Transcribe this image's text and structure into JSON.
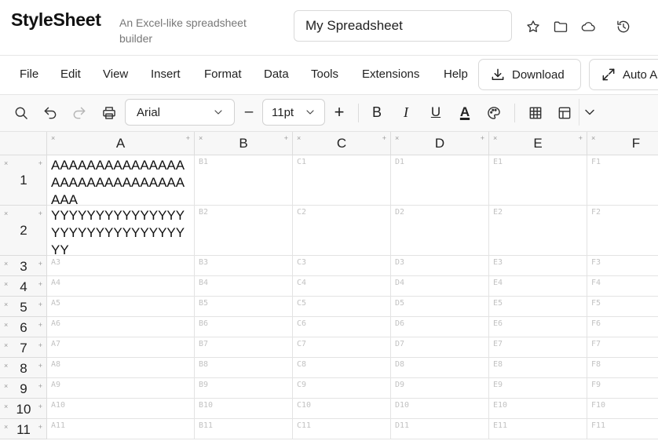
{
  "header": {
    "brand": "StyleSheet",
    "tagline": "An Excel-like spreadsheet builder",
    "title_value": "My Spreadsheet",
    "icons": [
      "star-icon",
      "folder-icon",
      "cloud-icon",
      "history-icon"
    ]
  },
  "menu": {
    "items": [
      "File",
      "Edit",
      "View",
      "Insert",
      "Format",
      "Data",
      "Tools",
      "Extensions",
      "Help"
    ],
    "download_label": "Download",
    "auto_label": "Auto A"
  },
  "toolbar": {
    "font": "Arial",
    "size": "11pt",
    "minus": "–",
    "plus": "+",
    "bold": "B",
    "italic": "I",
    "underline": "U",
    "text_color": "A"
  },
  "grid": {
    "columns": [
      "A",
      "B",
      "C",
      "D",
      "E",
      "F"
    ],
    "rows": [
      "1",
      "2",
      "3",
      "4",
      "5",
      "6",
      "7",
      "8",
      "9",
      "10",
      "11"
    ],
    "remove_glyph": "×",
    "add_glyph": "+",
    "cells": {
      "A1": "AAAAAAAAAAAAAAAAAAAAAAAAAAAAAAAAA",
      "A2": "YYYYYYYYYYYYYYYYYYYYYYYYYYYYYYYY"
    }
  }
}
